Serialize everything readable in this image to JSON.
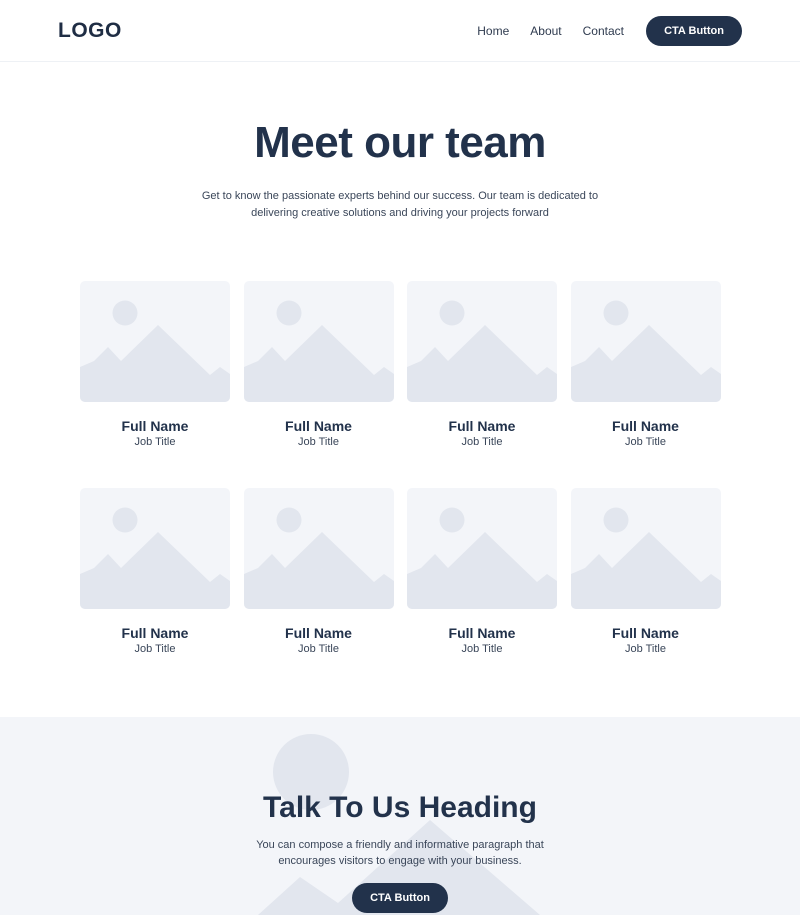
{
  "header": {
    "logo": "LOGO",
    "nav": [
      {
        "label": "Home"
      },
      {
        "label": "About"
      },
      {
        "label": "Contact"
      }
    ],
    "cta_label": "CTA Button"
  },
  "hero": {
    "title": "Meet our team",
    "description": "Get to know the passionate experts behind our success. Our team is dedicated to delivering creative solutions and driving your projects forward"
  },
  "team": [
    {
      "name": "Full Name",
      "title": "Job Title",
      "photo_icon": "image-placeholder-icon"
    },
    {
      "name": "Full Name",
      "title": "Job Title",
      "photo_icon": "image-placeholder-icon"
    },
    {
      "name": "Full Name",
      "title": "Job Title",
      "photo_icon": "image-placeholder-icon"
    },
    {
      "name": "Full Name",
      "title": "Job Title",
      "photo_icon": "image-placeholder-icon"
    },
    {
      "name": "Full Name",
      "title": "Job Title",
      "photo_icon": "image-placeholder-icon"
    },
    {
      "name": "Full Name",
      "title": "Job Title",
      "photo_icon": "image-placeholder-icon"
    },
    {
      "name": "Full Name",
      "title": "Job Title",
      "photo_icon": "image-placeholder-icon"
    },
    {
      "name": "Full Name",
      "title": "Job Title",
      "photo_icon": "image-placeholder-icon"
    }
  ],
  "talk": {
    "title": "Talk To Us Heading",
    "description": "You can compose a friendly and informative paragraph that encourages visitors to engage with your business.",
    "cta_label": "CTA Button"
  },
  "colors": {
    "primary": "#22324b",
    "placeholder_bg": "#f3f5f9",
    "placeholder_shape": "#e2e6ee"
  }
}
